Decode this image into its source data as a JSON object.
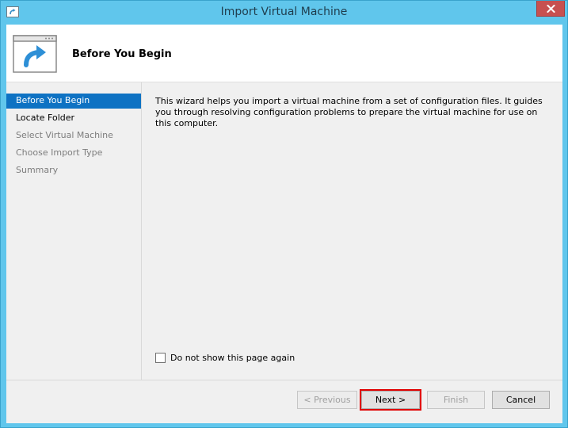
{
  "window": {
    "title": "Import Virtual Machine",
    "icon": "window-arrow-icon",
    "close_icon": "close-icon"
  },
  "header": {
    "title": "Before You Begin",
    "icon": "import-arrow-icon"
  },
  "nav": {
    "items": [
      {
        "label": "Before You Begin",
        "state": "active"
      },
      {
        "label": "Locate Folder",
        "state": "enabled"
      },
      {
        "label": "Select Virtual Machine",
        "state": "disabled"
      },
      {
        "label": "Choose Import Type",
        "state": "disabled"
      },
      {
        "label": "Summary",
        "state": "disabled"
      }
    ]
  },
  "content": {
    "description": "This wizard helps you import a virtual machine from a set of configuration files. It guides you through resolving configuration problems to prepare the virtual machine for use on this computer.",
    "checkbox_label": "Do not show this page again",
    "checkbox_checked": false
  },
  "buttons": {
    "previous": "< Previous",
    "next": "Next >",
    "finish": "Finish",
    "cancel": "Cancel"
  },
  "colors": {
    "frame": "#60c6ec",
    "selection": "#0e72c3",
    "close": "#c75050",
    "highlight": "#e00000"
  }
}
